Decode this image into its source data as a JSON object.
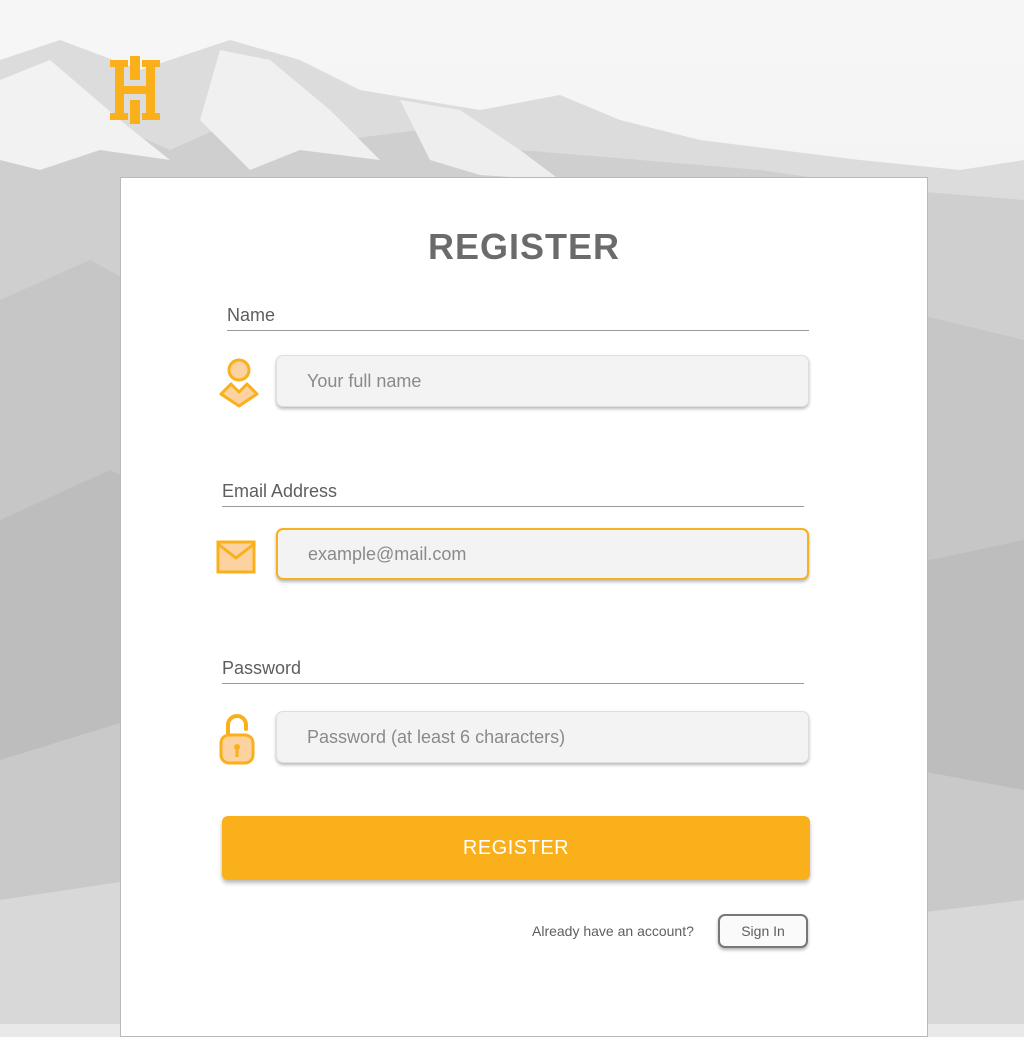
{
  "brand": {
    "accent": "#f9b01b",
    "logo_letter": "H"
  },
  "form": {
    "title": "REGISTER",
    "name": {
      "label": "Name",
      "placeholder": "Your full name",
      "icon": "user-icon"
    },
    "email": {
      "label": "Email Address",
      "placeholder": "example@mail.com",
      "icon": "envelope-icon"
    },
    "password": {
      "label": "Password",
      "placeholder": "Password (at least 6 characters)",
      "icon": "unlocked-padlock-icon"
    },
    "submit_label": "REGISTER",
    "already_text": "Already have an account?",
    "signin_label": "Sign In"
  }
}
